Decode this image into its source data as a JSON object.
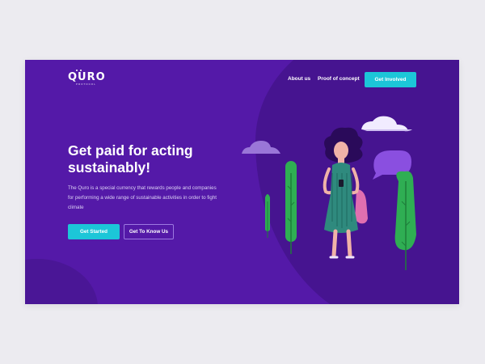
{
  "brand": {
    "logo_text": "QURO",
    "logo_subtext": "PROTOCOL"
  },
  "nav": {
    "items": [
      {
        "label": "About us"
      },
      {
        "label": "Proof of concept"
      }
    ],
    "cta_label": "Get Involved"
  },
  "hero": {
    "title": "Get paid for acting sustainably!",
    "description": "The Quro is a special currency that rewards people and companies for performing a wide range of sustainable activities in order to fight climate",
    "primary_label": "Get Started",
    "secondary_label": "Get To Know Us"
  },
  "colors": {
    "page_background": "#ecebf0",
    "hero_background": "#5419a8",
    "hero_blob": "#461490",
    "accent_cyan": "#1cc6d8",
    "tree_green": "#2fae53",
    "bubble_purple": "#8a4fe0",
    "dress_teal": "#2f8a7e"
  },
  "icons": [
    "cloud-icon",
    "speech-bubble-icon",
    "tree-icon",
    "woman-with-phone-illustration"
  ]
}
